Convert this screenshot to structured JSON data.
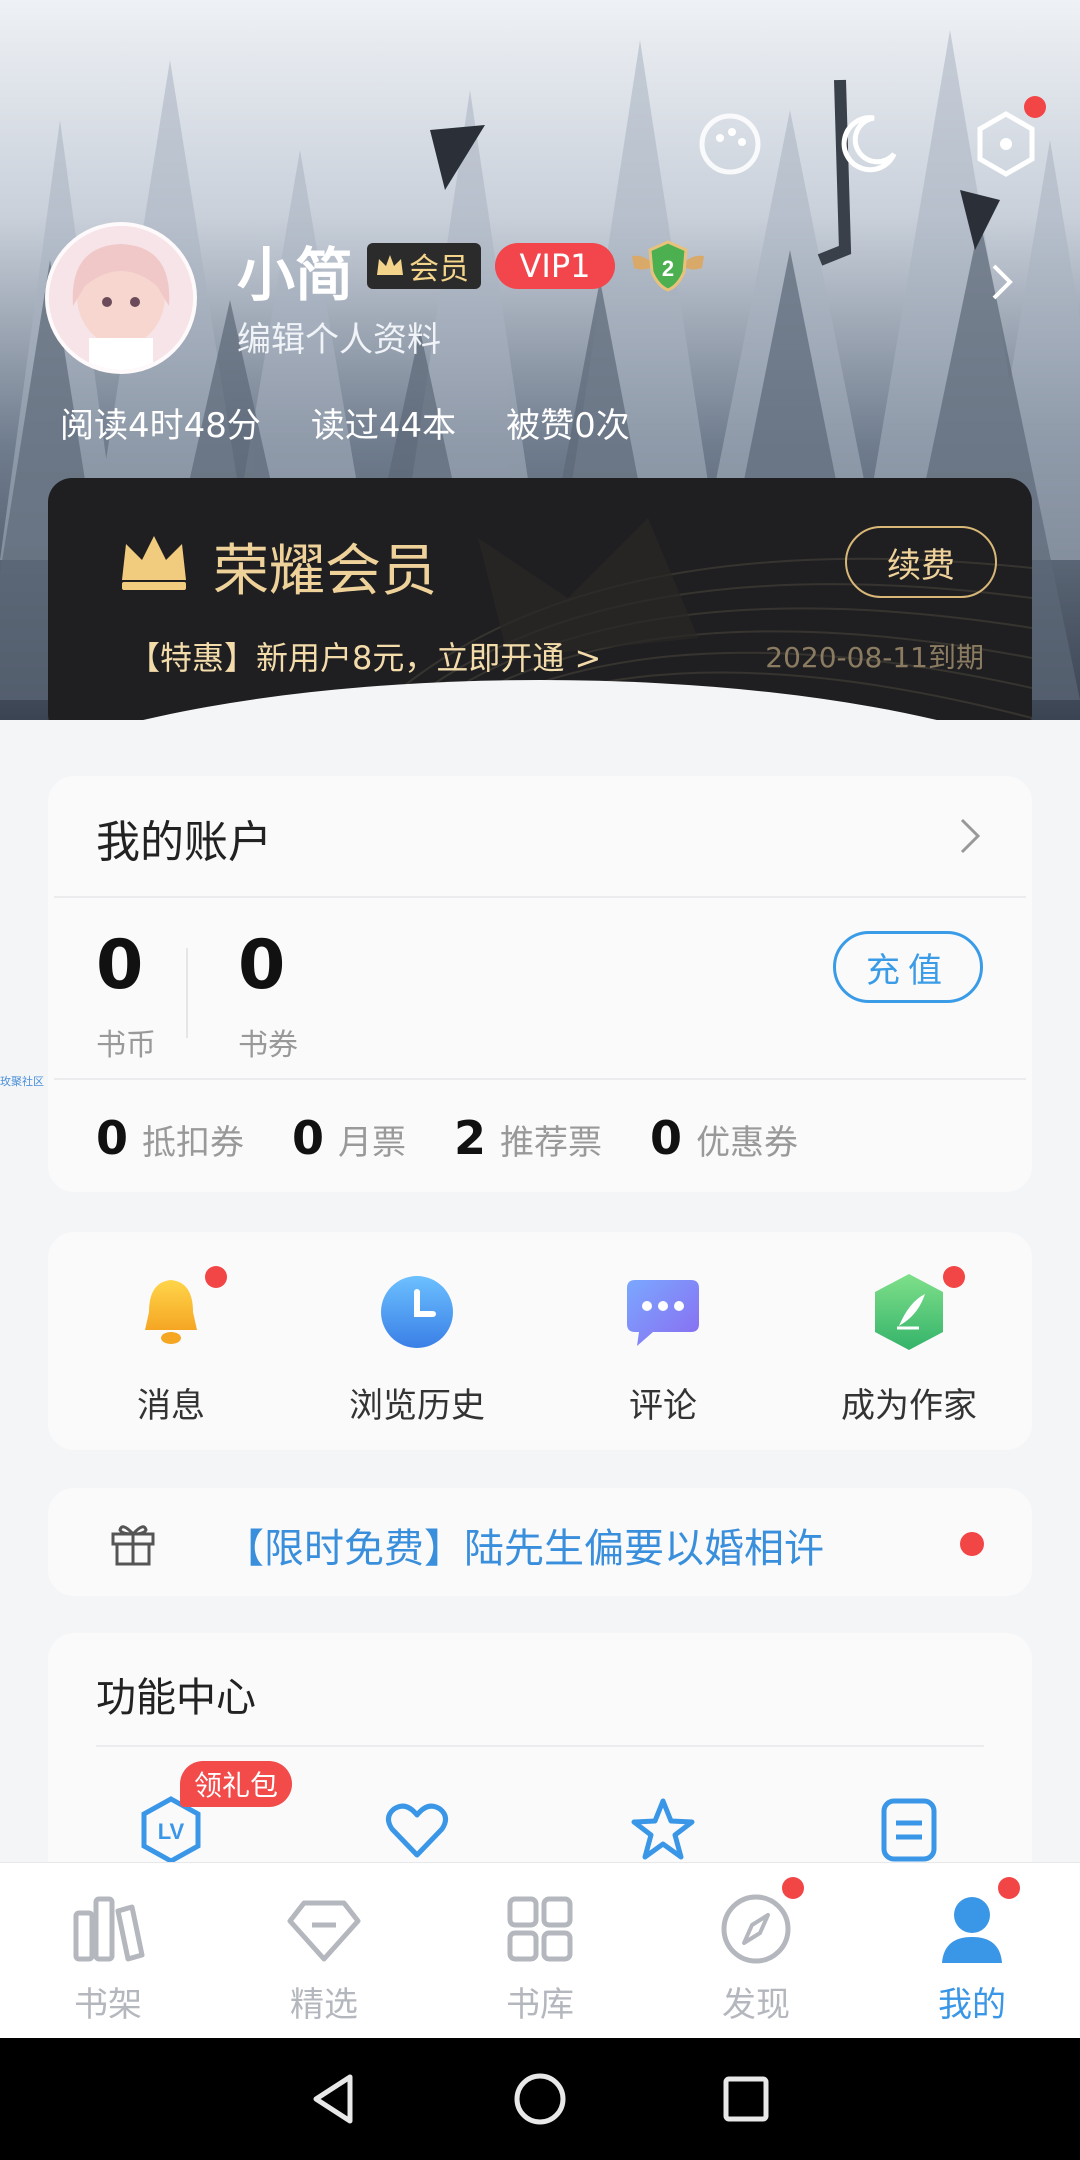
{
  "header": {
    "username": "小简",
    "member_tag": "会员",
    "vip_tag": "VIP1",
    "level_number": "2",
    "edit_profile": "编辑个人资料",
    "stats": [
      "阅读4时48分",
      "读过44本",
      "被赞0次"
    ],
    "top_icons": [
      "palette-icon",
      "moon-icon",
      "settings-hexagon-icon"
    ]
  },
  "vip_card": {
    "title": "荣耀会员",
    "renew": "续费",
    "promo": "【特惠】新用户8元，立即开通 >",
    "expire": "2020-08-11到期"
  },
  "account": {
    "title": "我的账户",
    "coins": {
      "value": "0",
      "label": "书币"
    },
    "vouchers": {
      "value": "0",
      "label": "书券"
    },
    "recharge": "充值",
    "tickets": [
      {
        "value": "0",
        "label": "抵扣券"
      },
      {
        "value": "0",
        "label": "月票"
      },
      {
        "value": "2",
        "label": "推荐票"
      },
      {
        "value": "0",
        "label": "优惠券"
      }
    ]
  },
  "watermark": "玫聚社区",
  "shortcuts": [
    {
      "label": "消息",
      "icon": "bell-icon"
    },
    {
      "label": "浏览历史",
      "icon": "clock-icon"
    },
    {
      "label": "评论",
      "icon": "comment-icon"
    },
    {
      "label": "成为作家",
      "icon": "pen-icon"
    }
  ],
  "banner": {
    "text": "【限时免费】陆先生偏要以婚相许"
  },
  "function_center": {
    "title": "功能中心",
    "gift_pill": "领礼包",
    "icons": [
      "level-icon",
      "heart-icon",
      "star-icon",
      "document-icon"
    ]
  },
  "nav": [
    {
      "label": "书架",
      "icon": "bookshelf-icon"
    },
    {
      "label": "精选",
      "icon": "diamond-icon"
    },
    {
      "label": "书库",
      "icon": "grid-icon"
    },
    {
      "label": "发现",
      "icon": "compass-icon"
    },
    {
      "label": "我的",
      "icon": "person-icon"
    }
  ],
  "colors": {
    "accent": "#3a96e6",
    "gold": "#efd29a",
    "red": "#f24545"
  }
}
